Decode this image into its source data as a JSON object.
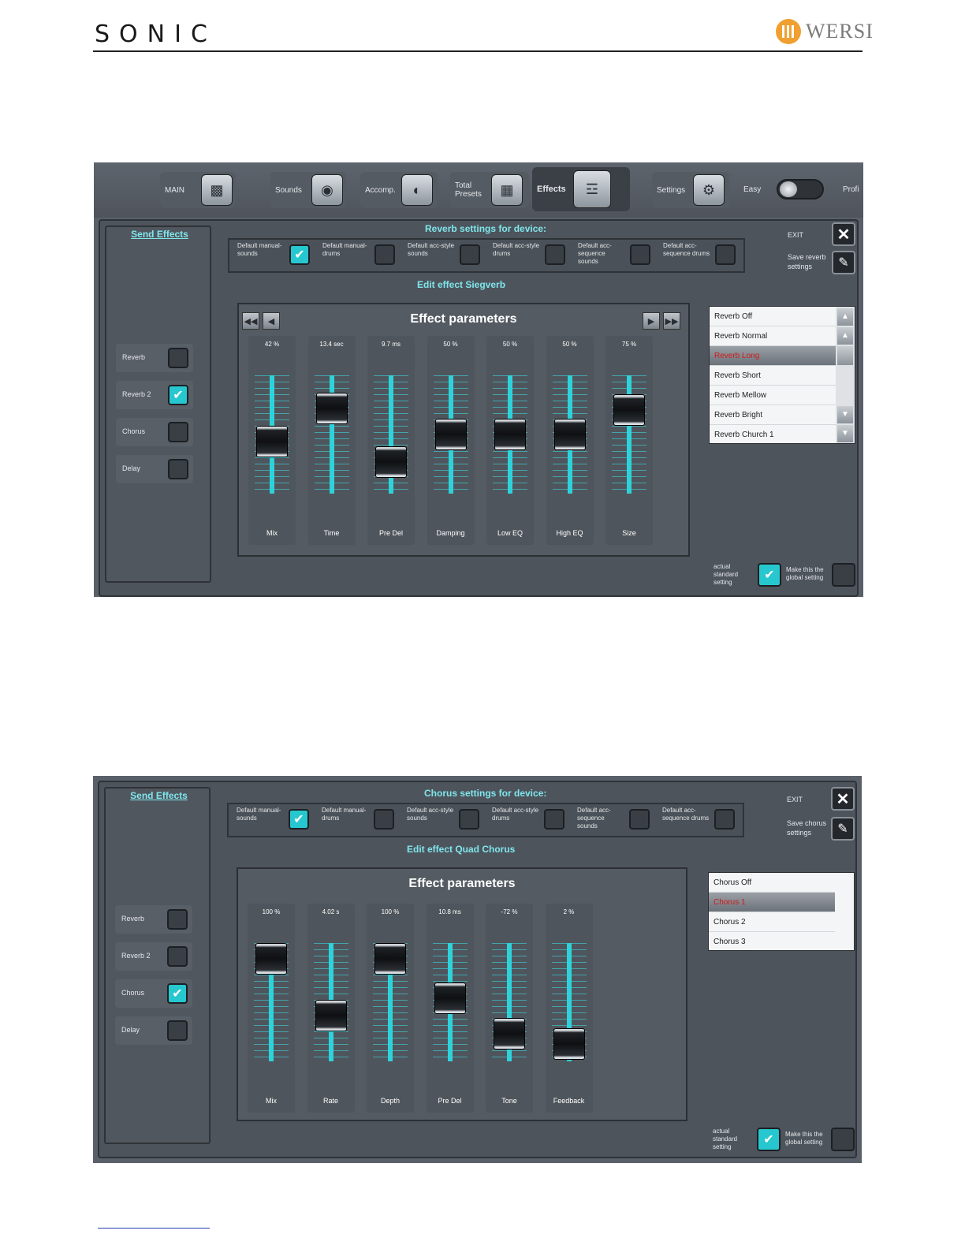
{
  "page": {
    "brand_left": "SONIC",
    "brand_right": "WERSI"
  },
  "reverb_screen": {
    "nav": {
      "main": "MAIN",
      "sounds": "Sounds",
      "accomp": "Accomp.",
      "total_presets_1": "Total",
      "total_presets_2": "Presets",
      "effects": "Effects",
      "settings": "Settings",
      "easy": "Easy",
      "profi": "Profi"
    },
    "send_effects_title": "Send Effects",
    "send_effects": [
      {
        "label": "Reverb",
        "checked": false
      },
      {
        "label": "Reverb 2",
        "checked": true
      },
      {
        "label": "Chorus",
        "checked": false
      },
      {
        "label": "Delay",
        "checked": false
      }
    ],
    "device_title": "Reverb settings for device:",
    "device_options": [
      {
        "label": "Default manual-sounds",
        "checked": true
      },
      {
        "label": "Default manual-drums",
        "checked": false
      },
      {
        "label": "Default acc-style sounds",
        "checked": false
      },
      {
        "label": "Default acc-style drums",
        "checked": false
      },
      {
        "label": "Default acc-sequence sounds",
        "checked": false
      },
      {
        "label": "Default acc-sequence drums",
        "checked": false
      }
    ],
    "edit_title": "Edit effect Siegverb",
    "exit_label": "EXIT",
    "save_label_1": "Save reverb",
    "save_label_2": "settings",
    "params_title": "Effect parameters",
    "faders": [
      {
        "name": "Mix",
        "value": "42 %",
        "level": 0.42
      },
      {
        "name": "Time",
        "value": "13.4 sec",
        "level": 0.8
      },
      {
        "name": "Pre Del",
        "value": "9.7 ms",
        "level": 0.18
      },
      {
        "name": "Damping",
        "value": "50 %",
        "level": 0.5
      },
      {
        "name": "Low EQ",
        "value": "50 %",
        "level": 0.5
      },
      {
        "name": "High EQ",
        "value": "50 %",
        "level": 0.5
      },
      {
        "name": "Size",
        "value": "75 %",
        "level": 0.78
      }
    ],
    "presets": [
      {
        "label": "Reverb Off",
        "selected": false
      },
      {
        "label": "Reverb Normal",
        "selected": false
      },
      {
        "label": "Reverb Long",
        "selected": true
      },
      {
        "label": "Reverb Short",
        "selected": false
      },
      {
        "label": "Reverb Mellow",
        "selected": false
      },
      {
        "label": "Reverb Bright",
        "selected": false
      },
      {
        "label": "Reverb Church 1",
        "selected": false
      }
    ],
    "actual_1": "actual",
    "actual_2": "standard",
    "actual_3": "setting",
    "actual_checked": true,
    "global_1": "Make this the",
    "global_2": "global setting",
    "global_checked": false
  },
  "chorus_screen": {
    "send_effects_title": "Send Effects",
    "send_effects": [
      {
        "label": "Reverb",
        "checked": false
      },
      {
        "label": "Reverb 2",
        "checked": false
      },
      {
        "label": "Chorus",
        "checked": true
      },
      {
        "label": "Delay",
        "checked": false
      }
    ],
    "device_title": "Chorus settings for device:",
    "device_options": [
      {
        "label": "Default manual-sounds",
        "checked": true
      },
      {
        "label": "Default manual-drums",
        "checked": false
      },
      {
        "label": "Default acc-style sounds",
        "checked": false
      },
      {
        "label": "Default acc-style drums",
        "checked": false
      },
      {
        "label": "Default acc-sequence sounds",
        "checked": false
      },
      {
        "label": "Default acc-sequence drums",
        "checked": false
      }
    ],
    "edit_title": "Edit effect Quad Chorus",
    "exit_label": "EXIT",
    "save_label_1": "Save chorus",
    "save_label_2": "settings",
    "params_title": "Effect parameters",
    "faders": [
      {
        "name": "Mix",
        "value": "100 %",
        "level": 1.0
      },
      {
        "name": "Rate",
        "value": "4.02 s",
        "level": 0.35
      },
      {
        "name": "Depth",
        "value": "100 %",
        "level": 1.0
      },
      {
        "name": "Pre Del",
        "value": "10.8 ms",
        "level": 0.55
      },
      {
        "name": "Tone",
        "value": "-72 %",
        "level": 0.14
      },
      {
        "name": "Feedback",
        "value": "2 %",
        "level": 0.02
      }
    ],
    "presets": [
      {
        "label": "Chorus Off",
        "selected": false
      },
      {
        "label": "Chorus 1",
        "selected": true
      },
      {
        "label": "Chorus 2",
        "selected": false
      },
      {
        "label": "Chorus 3",
        "selected": false
      }
    ],
    "actual_1": "actual",
    "actual_2": "standard",
    "actual_3": "setting",
    "actual_checked": true,
    "global_1": "Make this the",
    "global_2": "global setting",
    "global_checked": false
  }
}
